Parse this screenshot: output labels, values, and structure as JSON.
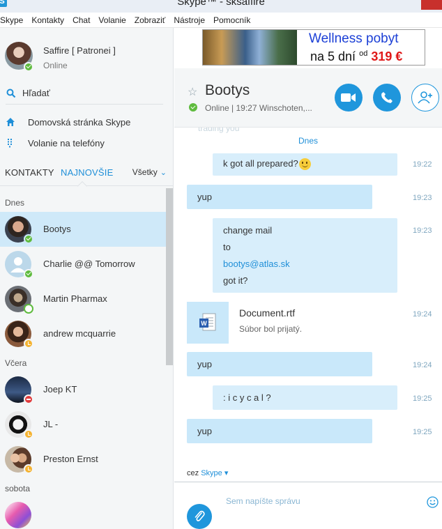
{
  "window": {
    "title": "Skype™ - sksaffire",
    "logo": "S"
  },
  "menu": [
    "Skype",
    "Kontakty",
    "Chat",
    "Volanie",
    "Zobraziť",
    "Nástroje",
    "Pomocník"
  ],
  "profile": {
    "name": "Saffire [ Patronei ]",
    "status": "Online"
  },
  "search": {
    "label": "Hľadať",
    "icon": "search-icon"
  },
  "nav": [
    {
      "label": "Domovská stránka Skype",
      "icon": "home-icon"
    },
    {
      "label": "Volanie na telefóny",
      "icon": "dialpad-icon"
    }
  ],
  "tabs": {
    "contacts": "KONTAKTY",
    "recent": "NAJNOVŠIE",
    "filter": "Všetky"
  },
  "groups": [
    {
      "label": "Dnes",
      "contacts": [
        {
          "name": "Bootys",
          "status": "online",
          "selected": true
        },
        {
          "name": "Charlie @@ Tomorrow",
          "status": "online"
        },
        {
          "name": "Martin Pharmax",
          "status": "offline"
        },
        {
          "name": "andrew mcquarrie",
          "status": "away"
        }
      ]
    },
    {
      "label": "Včera",
      "contacts": [
        {
          "name": "Joep KT",
          "status": "busy"
        },
        {
          "name": "JL -",
          "status": "away"
        },
        {
          "name": "Preston Ernst",
          "status": "away"
        }
      ]
    },
    {
      "label": "sobota",
      "contacts": []
    }
  ],
  "ad": {
    "title": "Wellness pobyt",
    "line_prefix": "na 5 dní",
    "od": "od",
    "price": "319 €"
  },
  "chat": {
    "name": "Bootys",
    "status": "Online  |  19:27 Winschoten,...",
    "ghost_text": "trading you",
    "date_separator": "Dnes",
    "messages": [
      {
        "dir": "out",
        "text": "k got all prepared?",
        "time": "19:22"
      },
      {
        "dir": "in",
        "text": "yup",
        "time": "19:23"
      },
      {
        "dir": "out",
        "lines": [
          "change mail",
          "to",
          "bootys@atlas.sk",
          "got it?"
        ],
        "time": "19:23"
      },
      {
        "dir": "in",
        "file": "Document.rtf",
        "file_status": "Súbor bol prijatý.",
        "time": "19:24"
      },
      {
        "dir": "in",
        "text": "yup",
        "time": "19:24"
      },
      {
        "dir": "out",
        "text": ": i c y c a l ?",
        "time": "19:25"
      },
      {
        "dir": "in",
        "text": "yup",
        "time": "19:25"
      }
    ],
    "via_prefix": "cez",
    "via_service": "Skype ▾",
    "compose_placeholder": "Sem napíšte správu"
  },
  "colors": {
    "accent": "#1f96dc",
    "online": "#5fbb3e",
    "away": "#f5b331",
    "busy": "#e13b3c",
    "selected_row": "#cfe9f9"
  }
}
